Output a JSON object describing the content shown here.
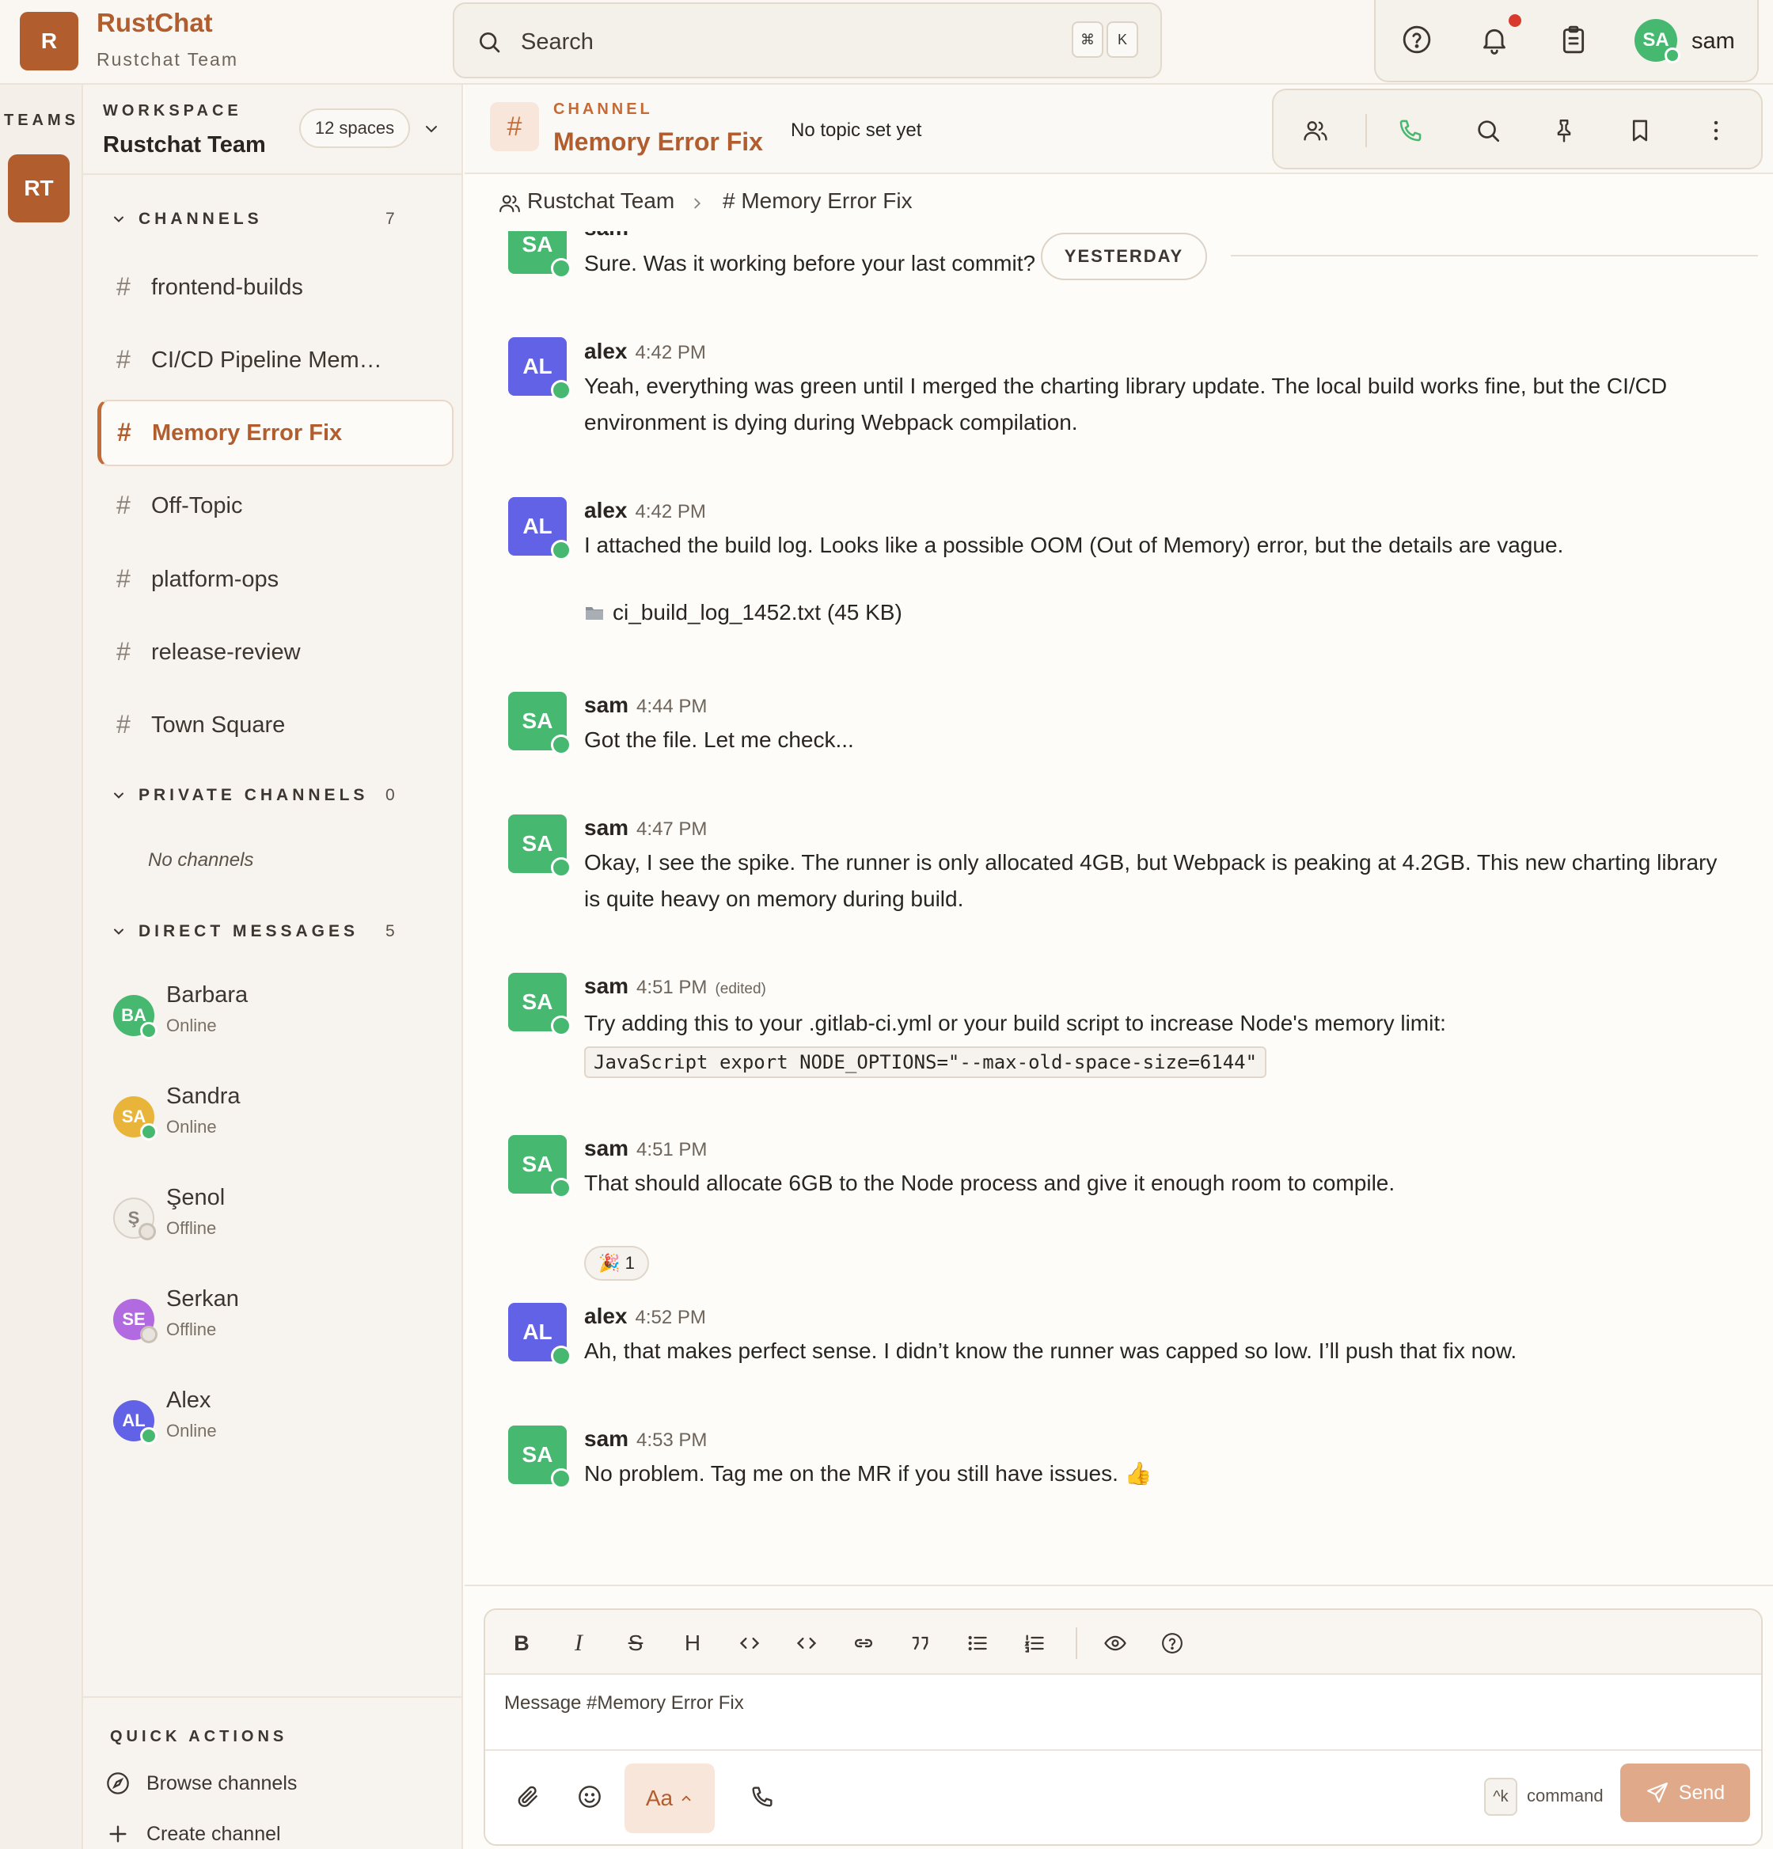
{
  "app": {
    "brand_initial": "R",
    "brand_name": "RustChat",
    "team_name": "Rustchat Team"
  },
  "search": {
    "placeholder": "Search",
    "shortcut_mod": "⌘",
    "shortcut_key": "K"
  },
  "user": {
    "initials": "SA",
    "name": "sam"
  },
  "teams_rail": {
    "label": "TEAMS",
    "active_team_initials": "RT"
  },
  "sidebar": {
    "workspace_label": "WORKSPACE",
    "workspace_name": "Rustchat Team",
    "spaces_badge": "12 spaces",
    "channels_label": "CHANNELS",
    "channels_count": "7",
    "channels": [
      {
        "label": "frontend-builds"
      },
      {
        "label": "CI/CD Pipeline Mem…"
      },
      {
        "label": "Memory Error Fix",
        "active": true
      },
      {
        "label": "Off-Topic"
      },
      {
        "label": "platform-ops"
      },
      {
        "label": "release-review"
      },
      {
        "label": "Town Square"
      }
    ],
    "private_label": "PRIVATE CHANNELS",
    "private_count": "0",
    "private_empty": "No channels",
    "dm_label": "DIRECT MESSAGES",
    "dm_count": "5",
    "dms": [
      {
        "initials": "BA",
        "name": "Barbara",
        "status": "Online",
        "color": "#47b870"
      },
      {
        "initials": "SA",
        "name": "Sandra",
        "status": "Online",
        "color": "#e8b43a"
      },
      {
        "initials": "Ş",
        "name": "Şenol",
        "status": "Offline",
        "color": "#c9c1b6"
      },
      {
        "initials": "SE",
        "name": "Serkan",
        "status": "Offline",
        "color": "#b26ae0"
      },
      {
        "initials": "AL",
        "name": "Alex",
        "status": "Online",
        "color": "#6262e6"
      }
    ],
    "quick_actions_label": "QUICK ACTIONS",
    "browse_channels": "Browse channels",
    "create_channel": "Create channel"
  },
  "channel": {
    "kind_label": "CHANNEL",
    "name": "Memory Error Fix",
    "topic": "No topic set yet",
    "hash": "#"
  },
  "breadcrumb": {
    "team": "Rustchat Team",
    "channel": "# Memory Error Fix"
  },
  "divider": {
    "label": "YESTERDAY"
  },
  "messages": [
    {
      "author": "sam",
      "initials": "SA",
      "time": "",
      "text": "Sure. Was it working before your last commit?"
    },
    {
      "author": "alex",
      "initials": "AL",
      "time": "4:42 PM",
      "text": "Yeah, everything was green until I merged the charting library update. The local build works fine, but the CI/CD environment is dying during Webpack compilation."
    },
    {
      "author": "alex",
      "initials": "AL",
      "time": "4:42 PM",
      "text": "I attached the build log. Looks like a possible OOM (Out of Memory) error, but the details are vague.",
      "attachment": "ci_build_log_1452.txt (45 KB)"
    },
    {
      "author": "sam",
      "initials": "SA",
      "time": "4:44 PM",
      "text": "Got the file. Let me check..."
    },
    {
      "author": "sam",
      "initials": "SA",
      "time": "4:47 PM",
      "text": "Okay, I see the spike. The runner is only allocated 4GB, but Webpack is peaking at 4.2GB. This new charting library is quite heavy on memory during build."
    },
    {
      "author": "sam",
      "initials": "SA",
      "time": "4:51 PM",
      "edited": "(edited)",
      "text": "Try adding this to your .gitlab-ci.yml or your build script to increase Node's memory limit:",
      "code": "JavaScript export NODE_OPTIONS=\"--max-old-space-size=6144\""
    },
    {
      "author": "sam",
      "initials": "SA",
      "time": "4:51 PM",
      "text": "That should allocate 6GB to the Node process and give it enough room to compile.",
      "reaction_emoji": "🎉",
      "reaction_count": "1"
    },
    {
      "author": "alex",
      "initials": "AL",
      "time": "4:52 PM",
      "text": "Ah, that makes perfect sense. I didn’t know the runner was capped so low. I’ll push that fix now."
    },
    {
      "author": "sam",
      "initials": "SA",
      "time": "4:53 PM",
      "text": "No problem. Tag me on the MR if you still have issues. 👍"
    }
  ],
  "composer": {
    "placeholder": "Message #Memory Error Fix",
    "format_label": "Aa",
    "cmd_key": "^k",
    "cmd_label": "command",
    "send_label": "Send"
  },
  "colors": {
    "accent": "#b25d2d",
    "online": "#47b870",
    "notification": "#d83a2d",
    "send_button": "#dfa98a"
  },
  "icons": [
    "search-icon",
    "help-icon",
    "bell-icon",
    "clipboard-icon",
    "members-icon",
    "phone-icon",
    "pin-icon",
    "bookmark-icon",
    "more-icon",
    "compass-icon",
    "plus-icon",
    "paperclip-icon",
    "smiley-icon",
    "send-icon"
  ]
}
